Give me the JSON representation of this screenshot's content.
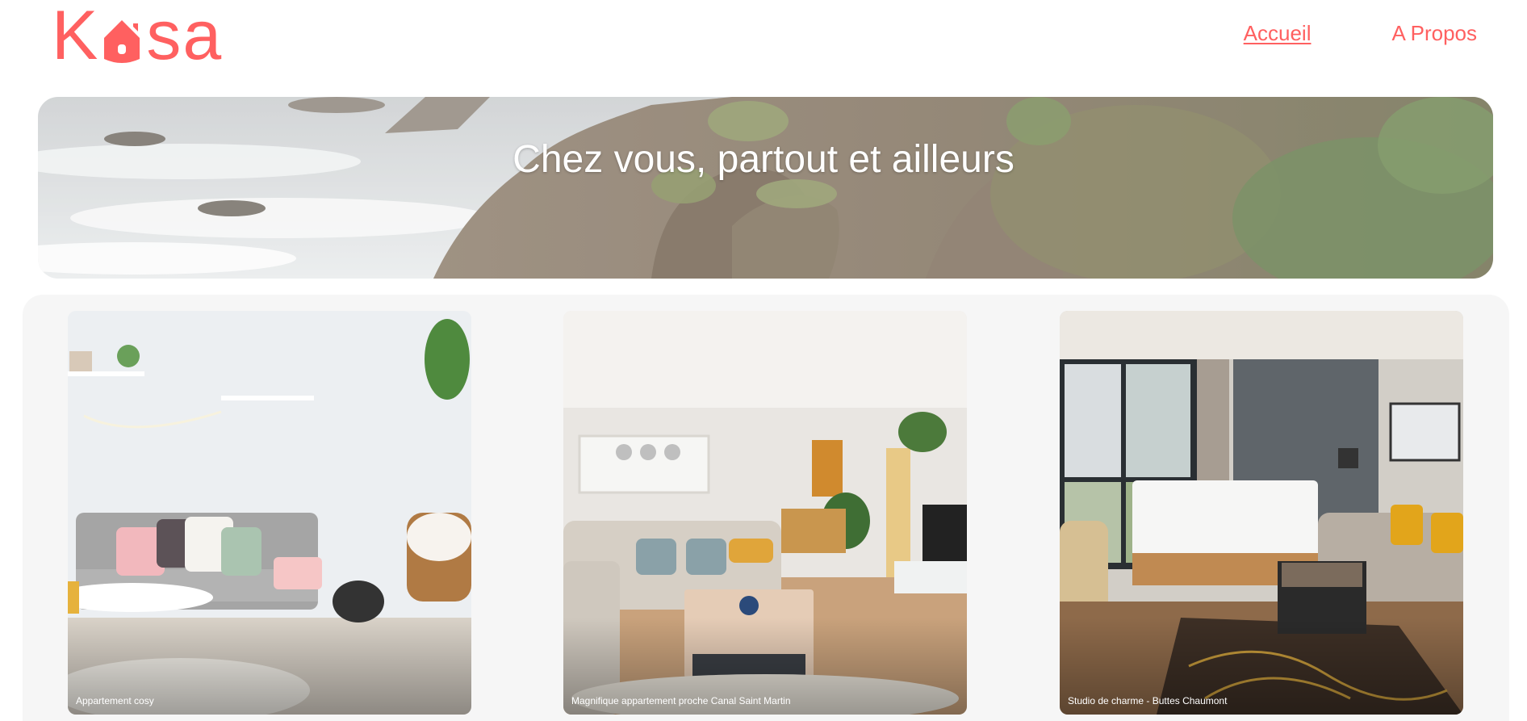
{
  "brand": {
    "logo_left": "K",
    "logo_right": "sa",
    "accent_color": "#FF6060"
  },
  "nav": {
    "items": [
      {
        "label": "Accueil",
        "active": true
      },
      {
        "label": "A Propos",
        "active": false
      }
    ]
  },
  "banner": {
    "title": "Chez vous, partout et ailleurs"
  },
  "gallery": {
    "cards": [
      {
        "title": "Appartement cosy"
      },
      {
        "title": "Magnifique appartement proche Canal Saint Martin"
      },
      {
        "title": "Studio de charme - Buttes Chaumont"
      }
    ]
  }
}
